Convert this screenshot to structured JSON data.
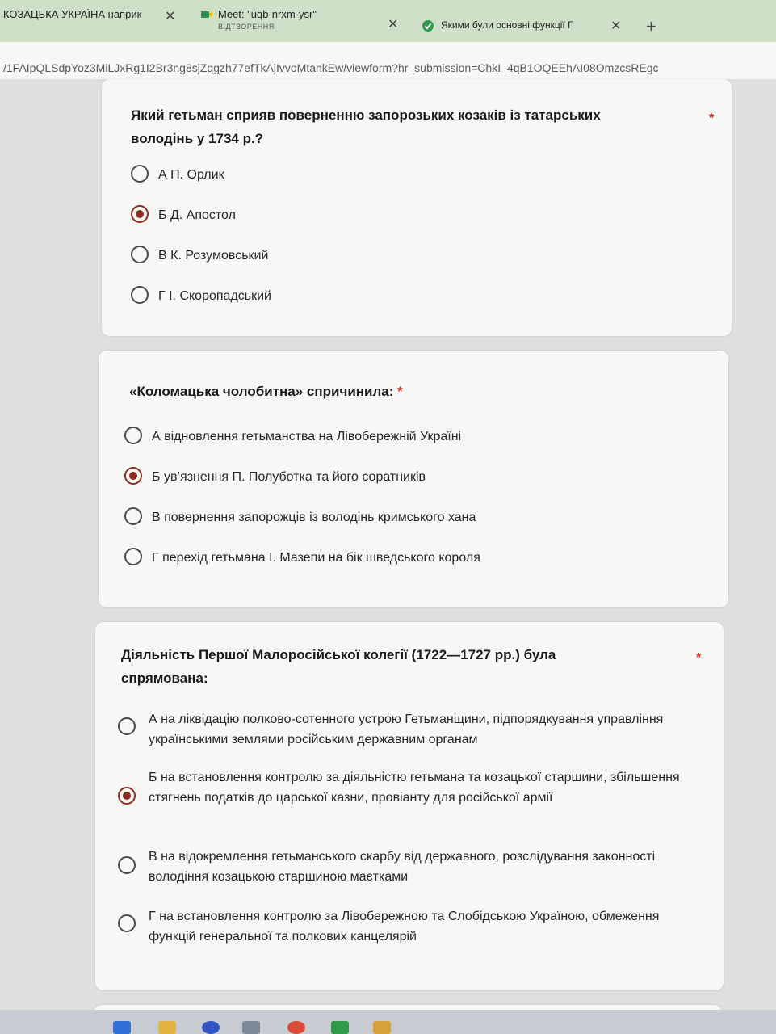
{
  "browser": {
    "tabs": [
      {
        "label": "КОЗАЦЬКА УКРАЇНА наприк",
        "sub": ""
      },
      {
        "label": "Meet: \"uqb-nrxm-ysr\"",
        "sub": "ВІДТВОРЕННЯ"
      },
      {
        "label": "Якими були основні функції Г",
        "sub": ""
      }
    ],
    "close_glyph": "✕",
    "new_tab_glyph": "+",
    "url": "/1FAIpQLSdpYoz3MiLJxRg1I2Br3ng8sjZqgzh77efTkAjIvvoMtankEw/viewform?hr_submission=ChkI_4qB1OQEEhAI08OmzcsREgc"
  },
  "questions": [
    {
      "title": "Який гетьман сприяв поверненню запорозьких козаків із татарських володінь у 1734 р.?",
      "required": "*",
      "options": [
        "А П. Орлик",
        "Б Д. Апостол",
        "В К. Розумовський",
        "Г І. Скоропадський"
      ],
      "selected_option": "Б Д. Апостол"
    },
    {
      "title": "«Коломацька чолобитна» спричинила:",
      "required": "*",
      "options": [
        "А відновлення гетьманства на Лівобережній Україні",
        "Б ув’язнення П. Полуботка та його соратників",
        "В повернення запорожців із володінь кримського хана",
        "Г перехід гетьмана І. Мазепи на бік шведського короля"
      ],
      "selected_option": "Б ув’язнення П. Полуботка та його соратників"
    },
    {
      "title": "Діяльність Першої Малоросійської колегії (1722—1727 рр.) була спрямована:",
      "required": "*",
      "options": [
        "А на ліквідацію полково-сотенного устрою Гетьманщини, підпорядкування управління українськими землями російським державним органам",
        "Б на встановлення контролю за діяльністю гетьмана та козацької старшини, збільшення стягнень податків до царської казни, провіанту для російської армії",
        "В на відокремлення гетьманського скарбу від державного, розслідування законності володіння козацькою старшиною маєтками",
        "Г на встановлення контролю за Лівобережною та Слобідською Україною, обмеження функцій генеральної та полкових канцелярій"
      ],
      "selected_option": "Б на встановлення контролю за діяльністю гетьмана та козацької старшини, збільшення стягнень податків до царської казни, провіанту для російської армії"
    }
  ],
  "colors": {
    "tabbar": "#cfe0c9",
    "accent_selected": "#8a2e1e",
    "required_star": "#d93025"
  }
}
